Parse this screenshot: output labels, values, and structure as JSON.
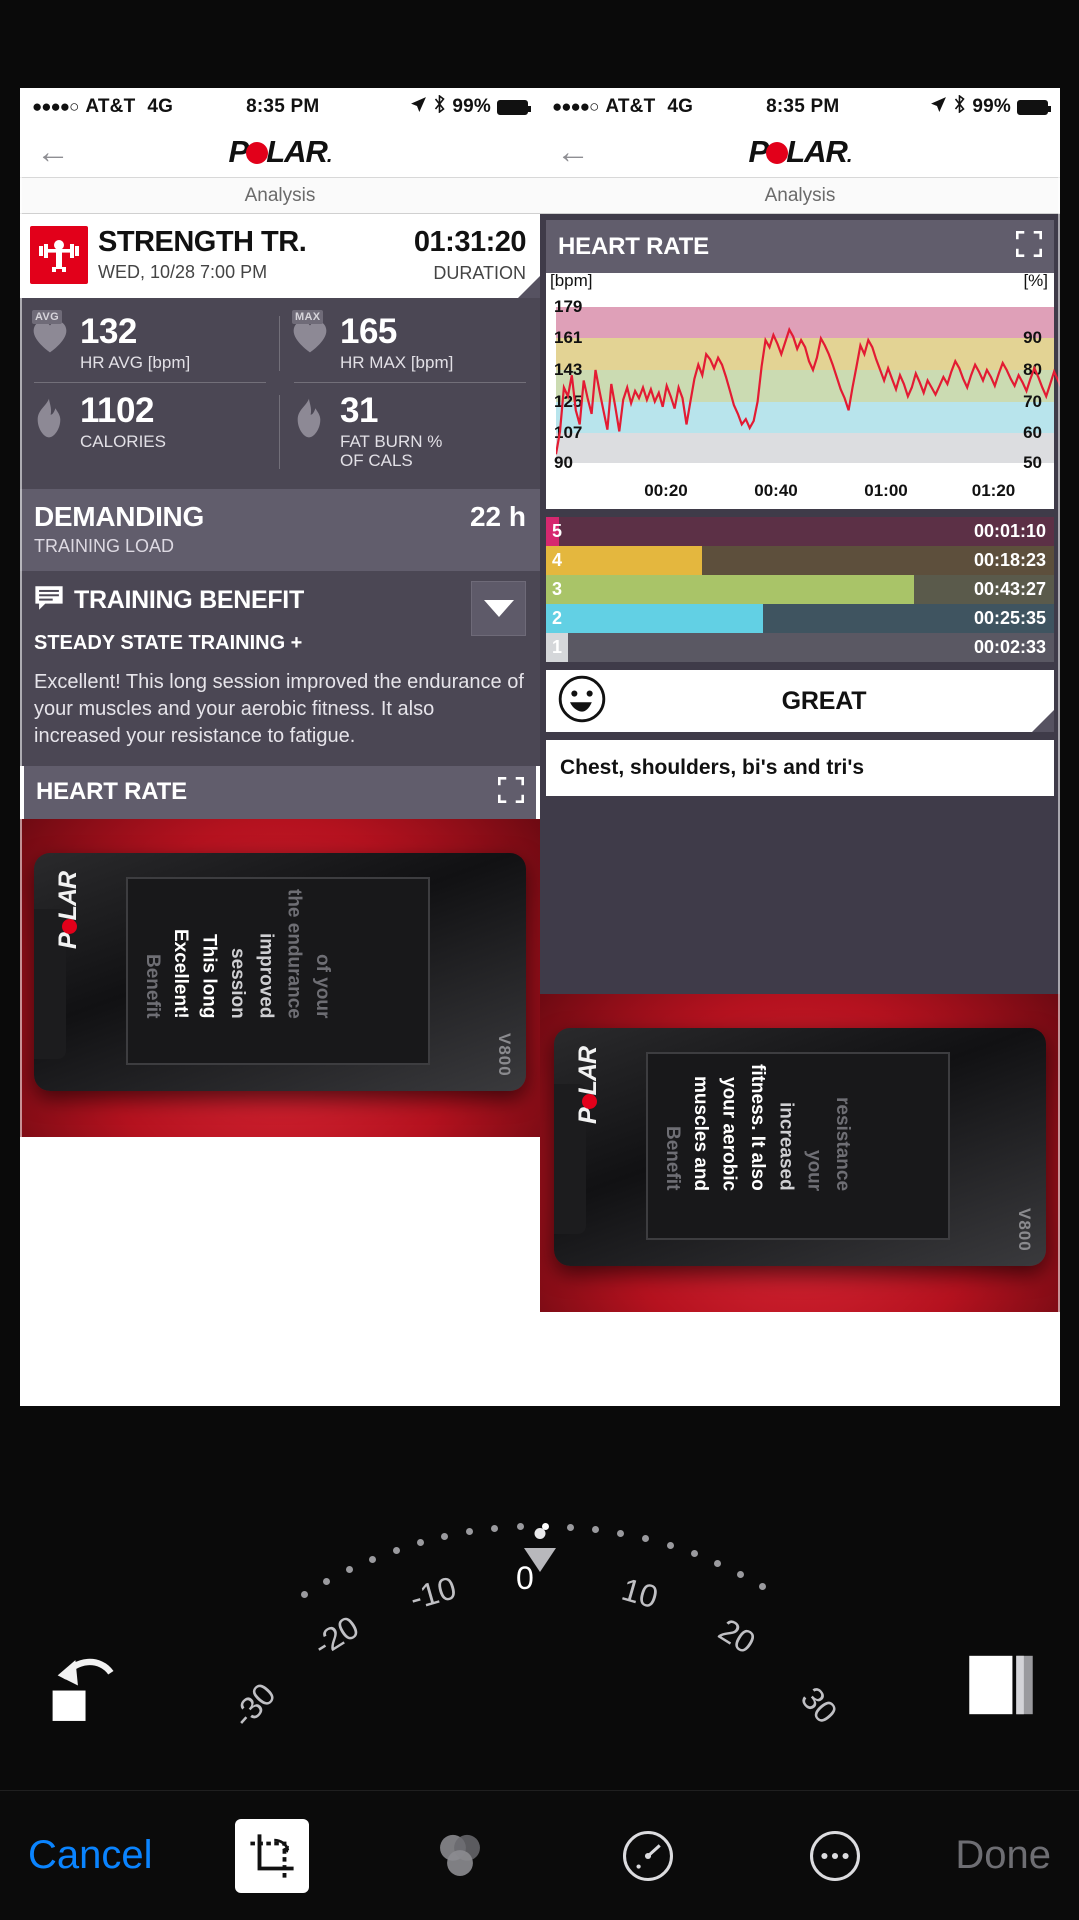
{
  "editor": {
    "toolbar": {
      "cancel_label": "Cancel",
      "done_label": "Done",
      "tools": [
        {
          "name": "crop-rotate-tool",
          "icon": "crop-rotate-icon",
          "active": true
        },
        {
          "name": "filters-tool",
          "icon": "filters-circles-icon",
          "active": false
        },
        {
          "name": "adjust-tool",
          "icon": "adjust-dial-icon",
          "active": false
        },
        {
          "name": "more-tool",
          "icon": "ellipsis-circle-icon",
          "active": false
        }
      ],
      "accent_color": "#0a84ff",
      "done_color": "#6e6e73"
    },
    "undo_button_label": "undo-arrow-icon",
    "aspect_button_label": "aspect-ratio-icon",
    "dial": {
      "ticks": [
        "-30",
        "-20",
        "-10",
        "0",
        "10",
        "20",
        "30"
      ],
      "selected": "0",
      "unit": "degrees"
    }
  },
  "shots": [
    {
      "id": "left",
      "statusbar": {
        "signal": "●●●●○",
        "carrier": "AT&T",
        "network": "4G",
        "time": "8:35 PM",
        "location_icon": "location-arrow-icon",
        "bluetooth_icon": "bluetooth-icon",
        "battery": "99%"
      },
      "nav": {
        "back_icon": "back-arrow-icon",
        "logo": "POLAR",
        "logo_suffix": "."
      },
      "tab": "Analysis",
      "session": {
        "sport_icon": "strength-training-icon",
        "title": "STRENGTH TR.",
        "date": "WED, 10/28 7:00 PM",
        "duration": "01:31:20",
        "duration_label": "DURATION"
      },
      "stats": [
        {
          "badge": "AVG",
          "icon": "heart-icon",
          "value": "132",
          "label": "HR AVG [bpm]"
        },
        {
          "badge": "MAX",
          "icon": "heart-icon",
          "value": "165",
          "label": "HR MAX [bpm]"
        },
        {
          "badge": "",
          "icon": "flame-icon",
          "value": "1102",
          "label": "CALORIES"
        },
        {
          "badge": "",
          "icon": "flame-icon",
          "value": "31",
          "label": "FAT BURN %\nOF CALS"
        }
      ],
      "training_load": {
        "level": "DEMANDING",
        "label": "TRAINING LOAD",
        "recovery": "22 h"
      },
      "training_benefit": {
        "icon": "speech-bubble-icon",
        "header": "TRAINING BENEFIT",
        "subtitle": "STEADY STATE TRAINING +",
        "body": "Excellent! This long session improved the endurance of your muscles and your aerobic fitness. It also increased your resistance to fatigue.",
        "disclosure_icon": "chevron-down-icon"
      },
      "hr_section": {
        "title": "HEART RATE",
        "expand_icon": "expand-icon"
      },
      "watch_photo": {
        "brand": "POLAR",
        "model": "V800",
        "screen_title": "Benefit",
        "screen_lines": [
          "Excellent!",
          "This long",
          "session",
          "improved",
          "the endurance",
          "of your"
        ]
      }
    },
    {
      "id": "right",
      "statusbar": {
        "signal": "●●●●○",
        "carrier": "AT&T",
        "network": "4G",
        "time": "8:35 PM",
        "location_icon": "location-arrow-icon",
        "bluetooth_icon": "bluetooth-icon",
        "battery": "99%"
      },
      "nav": {
        "back_icon": "back-arrow-icon",
        "logo": "POLAR",
        "logo_suffix": "."
      },
      "tab": "Analysis",
      "hr_section": {
        "title": "HEART RATE",
        "expand_icon": "expand-icon"
      },
      "feeling": {
        "icon": "smiley-face-icon",
        "label": "GREAT"
      },
      "note": "Chest, shoulders, bi's and tri's",
      "watch_photo": {
        "brand": "POLAR",
        "model": "V800",
        "screen_title": "Benefit",
        "screen_lines": [
          "muscles and",
          "your aerobic",
          "fitness. It also",
          "increased",
          "your",
          "resistance"
        ]
      }
    }
  ],
  "chart_data": {
    "type": "line",
    "title": "HEART RATE",
    "ylabel": "[bpm]",
    "y2label": "[%]",
    "xlabel": "",
    "yticks": [
      179,
      161,
      143,
      125,
      107,
      90
    ],
    "y2ticks": [
      90,
      80,
      70,
      60,
      50
    ],
    "ylim": [
      90,
      188
    ],
    "xticks": [
      "00:20",
      "00:40",
      "01:00",
      "01:20"
    ],
    "xlim": [
      "00:00",
      "01:31"
    ],
    "grid": false,
    "legend": "none",
    "line_color": "#e31b33",
    "zones_bands": [
      {
        "zone": 5,
        "from": 161,
        "to": 179,
        "color": "#dfa0b8"
      },
      {
        "zone": 4,
        "from": 143,
        "to": 161,
        "color": "#e3d394"
      },
      {
        "zone": 3,
        "from": 125,
        "to": 143,
        "color": "#cbdbb2"
      },
      {
        "zone": 2,
        "from": 107,
        "to": 125,
        "color": "#b8e4ec"
      },
      {
        "zone": 1,
        "from": 90,
        "to": 107,
        "color": "#dcdde0"
      }
    ],
    "series": [
      {
        "name": "Heart rate",
        "values": [
          95,
          108,
          133,
          128,
          140,
          120,
          112,
          137,
          127,
          118,
          143,
          131,
          120,
          109,
          135,
          122,
          108,
          126,
          133,
          124,
          131,
          127,
          133,
          126,
          132,
          125,
          130,
          122,
          134,
          128,
          121,
          133,
          127,
          112,
          125,
          138,
          146,
          140,
          152,
          149,
          144,
          150,
          146,
          139,
          131,
          123,
          118,
          112,
          115,
          110,
          114,
          125,
          145,
          160,
          156,
          163,
          158,
          152,
          159,
          166,
          162,
          155,
          160,
          156,
          148,
          143,
          150,
          161,
          157,
          152,
          146,
          139,
          132,
          127,
          120,
          133,
          145,
          157,
          152,
          160,
          156,
          149,
          143,
          137,
          144,
          138,
          132,
          140,
          135,
          128,
          133,
          141,
          136,
          130,
          137,
          133,
          129,
          134,
          139,
          135,
          142,
          148,
          144,
          138,
          133,
          140,
          146,
          142,
          137,
          143,
          139,
          134,
          141,
          147,
          143,
          138,
          134,
          140,
          136,
          131,
          138,
          144,
          139,
          133,
          128,
          135,
          142,
          137,
          132,
          139
        ]
      }
    ],
    "zone_durations": {
      "type": "bar",
      "orientation": "horizontal",
      "categories": [
        "5",
        "4",
        "3",
        "2",
        "1"
      ],
      "labels": [
        "00:01:10",
        "00:18:23",
        "00:43:27",
        "00:25:35",
        "00:02:33"
      ],
      "values_minutes": [
        1.17,
        18.38,
        43.45,
        25.58,
        2.55
      ],
      "total_minutes": 91.33,
      "colors": [
        "#d6286f",
        "#e4b73e",
        "#a9c468",
        "#62d0e4",
        "#d5d7da"
      ],
      "track_colors": [
        "#5c3046",
        "#5d4f3c",
        "#5a5a4b",
        "#3f5460",
        "#5a5863"
      ]
    }
  }
}
